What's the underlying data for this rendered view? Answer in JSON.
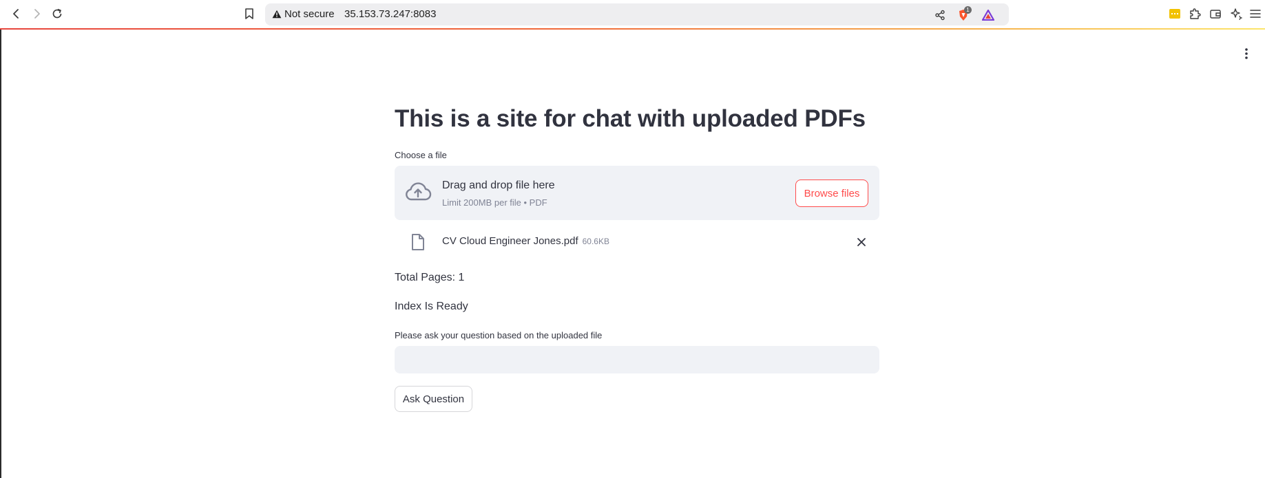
{
  "browser": {
    "security_label": "Not secure",
    "url": "35.153.73.247:8083",
    "brave_badge": "1"
  },
  "app": {
    "title": "This is a site for chat with uploaded PDFs",
    "uploader": {
      "label": "Choose a file",
      "dropzone_title": "Drag and drop file here",
      "dropzone_limit": "Limit 200MB per file • PDF",
      "browse_label": "Browse files"
    },
    "uploaded_file": {
      "name": "CV Cloud Engineer Jones.pdf",
      "size": "60.6KB"
    },
    "status": {
      "total_pages": "Total Pages: 1",
      "index_status": "Index Is Ready"
    },
    "question": {
      "label": "Please ask your question based on the uploaded file",
      "value": ""
    },
    "ask_button_label": "Ask Question"
  },
  "colors": {
    "primary": "#ff4b4b",
    "text": "#31333f",
    "muted": "#808495",
    "panel_bg": "#f0f2f6"
  }
}
